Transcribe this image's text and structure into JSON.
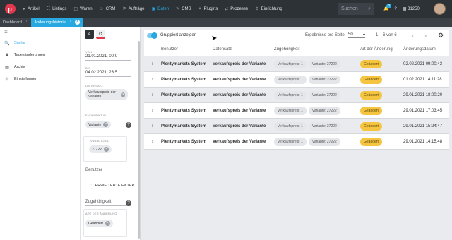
{
  "topbar": {
    "logo_letter": "p",
    "nav": [
      {
        "icon": "▸",
        "label": "Artikel",
        "active": false
      },
      {
        "icon": "☷",
        "label": "Listings",
        "active": false
      },
      {
        "icon": "◫",
        "label": "Waren",
        "active": false
      },
      {
        "icon": "☺",
        "label": "CRM",
        "active": false
      },
      {
        "icon": "⚑",
        "label": "Aufträge",
        "active": false
      },
      {
        "icon": "▣",
        "label": "Daten",
        "active": true
      },
      {
        "icon": "✎",
        "label": "CMS",
        "active": false
      },
      {
        "icon": "✦",
        "label": "Plugins",
        "active": false
      },
      {
        "icon": "⇄",
        "label": "Prozesse",
        "active": false
      },
      {
        "icon": "⚙",
        "label": "Einrichtung",
        "active": false
      }
    ],
    "search_placeholder": "Suchen",
    "notification_count": "3",
    "help": "?",
    "account_id": "31250"
  },
  "tabs": [
    {
      "label": "Dashboard",
      "active": false
    },
    {
      "label": "Änderungshistorie",
      "active": true
    }
  ],
  "sidebar": {
    "menu_icon": "≡",
    "items": [
      {
        "icon": "🔍",
        "label": "Suche",
        "active": true
      },
      {
        "icon": "⬇",
        "label": "Tagesänderungen",
        "active": false
      },
      {
        "icon": "▤",
        "label": "Archiv",
        "active": false
      },
      {
        "icon": "⚙",
        "label": "Einstellungen",
        "active": false
      }
    ]
  },
  "filter": {
    "from_label": "VON",
    "from_value": "21.01.2021, 00:0",
    "to_label": "BIS",
    "to_value": "04.02.2021, 23:5",
    "dataset_label": "DATENSATZ",
    "dataset_chip": "Verkaufspreis der Variante",
    "entity_label": "ENDPUNKT ID",
    "entity_chip": "Variante",
    "variation_label": "VARIATIONID",
    "variation_chip": "27222",
    "user_label": "Benutzer",
    "extended_label": "ERWEITERTE FILTER",
    "relation_label": "Zugehörigkeit",
    "change_label": "ART DER ÄNDERUNG",
    "change_chip": "Geändert"
  },
  "toolbar": {
    "group_label": "Gruppiert anzeigen",
    "per_page_label": "Ergebnisse pro Seite",
    "per_page_value": "50",
    "range": "1 – 6 von 6"
  },
  "table": {
    "headers": [
      "Benutzer",
      "Datensatz",
      "Zugehörigkeit",
      "Art der Änderung",
      "Änderungsdatum"
    ],
    "rows": [
      {
        "user": "Plentymarkets System",
        "dataset": "Verkaufspreis der Variante",
        "rel1": "Verkaufspreis: 1",
        "rel2": "Variante: 27222",
        "change": "Geändert",
        "date": "02.02.2021 09:00:43"
      },
      {
        "user": "Plentymarkets System",
        "dataset": "Verkaufspreis der Variante",
        "rel1": "Verkaufspreis: 1",
        "rel2": "Variante: 27222",
        "change": "Geändert",
        "date": "01.02.2021 14:11:28"
      },
      {
        "user": "Plentymarkets System",
        "dataset": "Verkaufspreis der Variante",
        "rel1": "Verkaufspreis: 1",
        "rel2": "Variante: 27222",
        "change": "Geändert",
        "date": "29.01.2021 18:00:20"
      },
      {
        "user": "Plentymarkets System",
        "dataset": "Verkaufspreis der Variante",
        "rel1": "Verkaufspreis: 1",
        "rel2": "Variante: 27222",
        "change": "Geändert",
        "date": "29.01.2021 17:03:45"
      },
      {
        "user": "Plentymarkets System",
        "dataset": "Verkaufspreis der Variante",
        "rel1": "Verkaufspreis: 1",
        "rel2": "Variante: 27222",
        "change": "Geändert",
        "date": "29.01.2021 15:24:47"
      },
      {
        "user": "Plentymarkets System",
        "dataset": "Verkaufspreis der Variante",
        "rel1": "Verkaufspreis: 1",
        "rel2": "Variante: 27222",
        "change": "Geändert",
        "date": "29.01.2021 14:15:48"
      }
    ]
  }
}
